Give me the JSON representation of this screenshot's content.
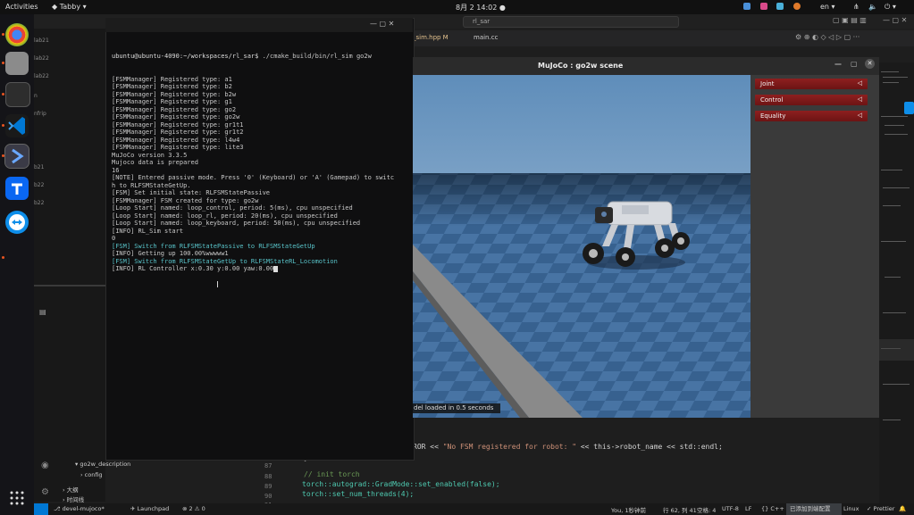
{
  "topbar": {
    "activities": "Activities",
    "app": "Tabby",
    "clock": "8月 2  14:02",
    "lang": "en"
  },
  "vscode": {
    "title_search": "rl_sar",
    "tabs": [
      {
        "label": "_sim.hpp M"
      },
      {
        "label": "main.cc"
      }
    ],
    "sidebar": {
      "items": [
        "lab21",
        "lab22",
        "lab22",
        "n",
        "nfrip",
        "b21",
        "b22",
        "b22"
      ],
      "tree": [
        "go2w_description",
        "config",
        "大纲",
        "时间线"
      ]
    },
    "code": {
      "line_numbers": [
        "87",
        "88",
        "89",
        "90",
        "91"
      ],
      "error_line_prefix": "ROR << ",
      "error_string": "\"No FSM registered for robot: \"",
      "error_suffix": " << this->robot_name << std::endl;",
      "brace": "}",
      "comment": "// init torch",
      "line89": "torch::autograd::GradMode::set_enabled(false);",
      "line90": "torch::set_num_threads(4);"
    },
    "status": {
      "branch": "devel-mujoco*",
      "launchpad": "Launchpad",
      "problems": "⊗ 2 ⚠ 0",
      "cursor": "You, 1秒钟前",
      "position": "行 62, 列 41",
      "spaces": "空格: 4",
      "encoding": "UTF-8",
      "eol": "LF",
      "lang": "C++",
      "status_msg": "已添加到端配置",
      "os": "Linux",
      "prettier": "✓ Prettier"
    }
  },
  "terminal": {
    "prompt": "ubuntu@ubuntu-4090:~/workspaces/rl_sar$",
    "command": " ./cmake_build/bin/rl_sim go2w",
    "lines": [
      {
        "text": "[FSMManager] Registered type: a1",
        "cls": ""
      },
      {
        "text": "[FSMManager] Registered type: b2",
        "cls": ""
      },
      {
        "text": "[FSMManager] Registered type: b2w",
        "cls": ""
      },
      {
        "text": "[FSMManager] Registered type: g1",
        "cls": ""
      },
      {
        "text": "[FSMManager] Registered type: go2",
        "cls": ""
      },
      {
        "text": "[FSMManager] Registered type: go2w",
        "cls": ""
      },
      {
        "text": "[FSMManager] Registered type: gr1t1",
        "cls": ""
      },
      {
        "text": "[FSMManager] Registered type: gr1t2",
        "cls": ""
      },
      {
        "text": "[FSMManager] Registered type: l4w4",
        "cls": ""
      },
      {
        "text": "[FSMManager] Registered type: lite3",
        "cls": ""
      },
      {
        "text": "MuJoCo version 3.3.5",
        "cls": ""
      },
      {
        "text": "Mujoco data is prepared",
        "cls": ""
      },
      {
        "text": "16",
        "cls": ""
      },
      {
        "text": "[NOTE] Entered passive mode. Press '0' (Keyboard) or 'A' (Gamepad) to switc",
        "cls": ""
      },
      {
        "text": "h to RLFSMStateGetUp.",
        "cls": ""
      },
      {
        "text": "[FSM] Set initial state: RLFSMStatePassive",
        "cls": ""
      },
      {
        "text": "[FSMManager] FSM created for type: go2w",
        "cls": ""
      },
      {
        "text": "[Loop Start] named: loop_control, period: 5(ms), cpu unspecified",
        "cls": ""
      },
      {
        "text": "[Loop Start] named: loop_rl, period: 20(ms), cpu unspecified",
        "cls": ""
      },
      {
        "text": "[Loop Start] named: loop_keyboard, period: 50(ms), cpu unspecified",
        "cls": ""
      },
      {
        "text": "[INFO] RL_Sim start",
        "cls": ""
      },
      {
        "text": "0",
        "cls": ""
      },
      {
        "text": "[FSM] Switch from RLFSMStatePassive to RLFSMStateGetUp",
        "cls": "cyan"
      },
      {
        "text": "[INFO] Getting up 100.00%wwwww1",
        "cls": ""
      },
      {
        "text": "[FSM] Switch from RLFSMStateGetUp to RLFSMStateRL_Locomotion",
        "cls": "cyan"
      },
      {
        "text": "[INFO] RL Controller x:0.30 y:0.00 yaw:0.00",
        "cls": ""
      }
    ]
  },
  "mujoco": {
    "title": "MuJoCo : go2w scene",
    "buttons": [
      {
        "label": "Joint",
        "arrow": "◁"
      },
      {
        "label": "Control",
        "arrow": "◁"
      },
      {
        "label": "Equality",
        "arrow": "◁"
      }
    ],
    "status": "del loaded in 0.5 seconds"
  }
}
